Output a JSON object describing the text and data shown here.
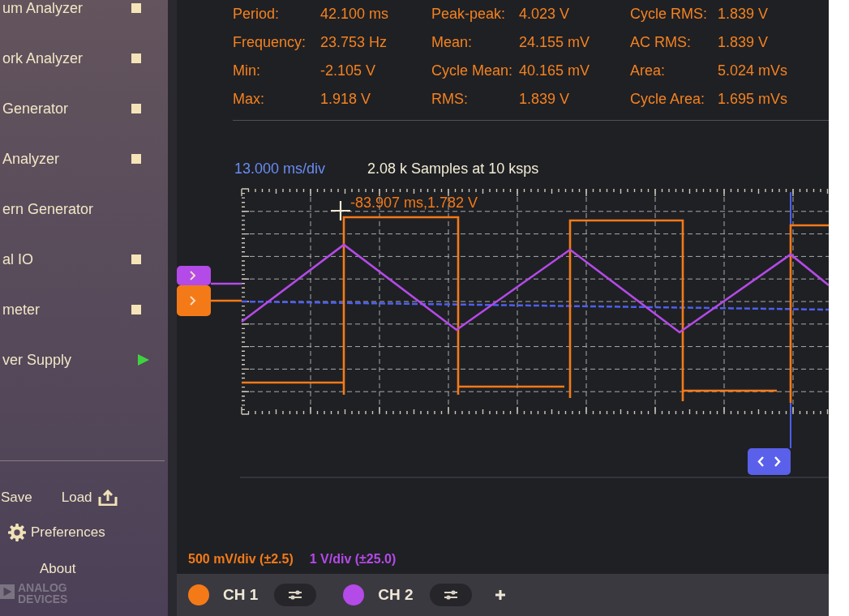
{
  "sidebar": {
    "tools": [
      {
        "label": "um Analyzer",
        "kind": "stop"
      },
      {
        "label": "ork Analyzer",
        "kind": "stop"
      },
      {
        "label": "Generator",
        "kind": "stop"
      },
      {
        "label": "Analyzer",
        "kind": "stop"
      },
      {
        "label": "ern Generator",
        "kind": "plain"
      },
      {
        "label": "al IO",
        "kind": "stop"
      },
      {
        "label": "meter",
        "kind": "stop"
      },
      {
        "label": "ver Supply",
        "kind": "play"
      }
    ],
    "save": "Save",
    "load": "Load",
    "preferences": "Preferences",
    "about": "About",
    "logo": [
      "ANALOG",
      "DEVICES"
    ]
  },
  "measurements": {
    "columns": [
      [
        {
          "label": "Period:",
          "value": "42.100 ms"
        },
        {
          "label": "Frequency:",
          "value": "23.753 Hz"
        },
        {
          "label": "Min:",
          "value": "-2.105 V"
        },
        {
          "label": "Max:",
          "value": "1.918 V"
        }
      ],
      [
        {
          "label": "Peak-peak:",
          "value": "4.023 V"
        },
        {
          "label": "Mean:",
          "value": "24.155 mV"
        },
        {
          "label": "Cycle Mean:",
          "value": "40.165 mV"
        },
        {
          "label": "RMS:",
          "value": "1.839 V"
        }
      ],
      [
        {
          "label": "Cycle RMS:",
          "value": "1.839 V"
        },
        {
          "label": "AC RMS:",
          "value": "1.839 V"
        },
        {
          "label": "Area:",
          "value": "5.024 mVs"
        },
        {
          "label": "Cycle Area:",
          "value": "1.695 mVs"
        }
      ]
    ]
  },
  "plot": {
    "timebase": "13.000 ms/div",
    "samples": "2.08 k Samples at 10 ksps",
    "cursor_readout": "-83.907 ms,1.782 V"
  },
  "channels": [
    {
      "label": "CH 1",
      "scale": "500 mV/div (±2.5)",
      "color": "#f47a18"
    },
    {
      "label": "CH 2",
      "scale": "1 V/div (±25.0)",
      "color": "#b44ae8"
    }
  ]
}
